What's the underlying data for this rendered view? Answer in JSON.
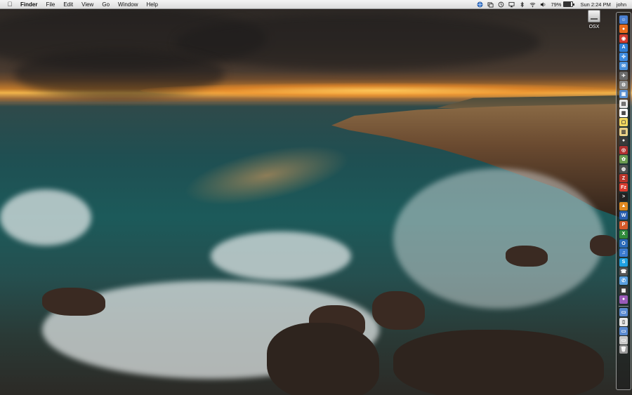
{
  "menubar": {
    "apple_icon": "apple-icon",
    "menus": [
      "Finder",
      "File",
      "Edit",
      "View",
      "Go",
      "Window",
      "Help"
    ],
    "status": {
      "battery_percent": "79%",
      "battery_level": 0.79,
      "clock": "Sun 2:24 PM",
      "user": "john"
    },
    "status_icons": [
      "globe-icon",
      "mirror-icon",
      "time-machine-icon",
      "airplay-icon",
      "bluetooth-icon",
      "wifi-icon",
      "volume-icon"
    ]
  },
  "desktop": {
    "icons": [
      {
        "label": "OSX",
        "icon": "hard-drive-icon"
      }
    ]
  },
  "dock": {
    "items": [
      {
        "name": "finder",
        "color": "#4a7fd0",
        "glyph": "☺"
      },
      {
        "name": "firefox",
        "color": "#e86a1c",
        "glyph": "●"
      },
      {
        "name": "chrome",
        "color": "#d23b2f",
        "glyph": "◉"
      },
      {
        "name": "app-store",
        "color": "#2f7fd6",
        "glyph": "A"
      },
      {
        "name": "safari",
        "color": "#3d8be0",
        "glyph": "✣"
      },
      {
        "name": "mail",
        "color": "#4a90d9",
        "glyph": "✉"
      },
      {
        "name": "launchpad",
        "color": "#6a6a6a",
        "glyph": "✈"
      },
      {
        "name": "system-preferences",
        "color": "#8a8a8a",
        "glyph": "⚙"
      },
      {
        "name": "preview",
        "color": "#5a8fd0",
        "glyph": "▣"
      },
      {
        "name": "textedit",
        "color": "#e8e8e8",
        "glyph": "▤"
      },
      {
        "name": "calendar",
        "color": "#ffffff",
        "glyph": "▦"
      },
      {
        "name": "stickies",
        "color": "#f0d860",
        "glyph": "▢"
      },
      {
        "name": "notes",
        "color": "#e8d088",
        "glyph": "▥"
      },
      {
        "name": "facetime",
        "color": "#3a3a3a",
        "glyph": "●"
      },
      {
        "name": "photo-booth",
        "color": "#b03030",
        "glyph": "◎"
      },
      {
        "name": "iphoto",
        "color": "#6a9a50",
        "glyph": "✿"
      },
      {
        "name": "dvd-player",
        "color": "#505050",
        "glyph": "◍"
      },
      {
        "name": "filezilla",
        "color": "#b8342a",
        "glyph": "Z"
      },
      {
        "name": "filezilla-alt",
        "color": "#d8392c",
        "glyph": "Fz"
      },
      {
        "name": "terminal",
        "color": "#222222",
        "glyph": ">"
      },
      {
        "name": "vlc",
        "color": "#e08a20",
        "glyph": "▲"
      },
      {
        "name": "word",
        "color": "#2b5fb0",
        "glyph": "W"
      },
      {
        "name": "powerpoint",
        "color": "#d45a2a",
        "glyph": "P"
      },
      {
        "name": "excel",
        "color": "#2f8a3a",
        "glyph": "X"
      },
      {
        "name": "outlook",
        "color": "#2a6ab8",
        "glyph": "O"
      },
      {
        "name": "itunes",
        "color": "#3a7ad0",
        "glyph": "♫"
      },
      {
        "name": "skype",
        "color": "#1fa0e0",
        "glyph": "S"
      },
      {
        "name": "wifi-diagnostics",
        "color": "#555555",
        "glyph": "☎"
      },
      {
        "name": "messages",
        "color": "#5aa0e0",
        "glyph": "✆"
      },
      {
        "name": "activity-monitor",
        "color": "#3a3a3a",
        "glyph": "▩"
      },
      {
        "name": "game-center",
        "color": "#9a5ab8",
        "glyph": "●"
      },
      {
        "name": "applications-folder",
        "color": "#5a8ad0",
        "glyph": "▭"
      },
      {
        "name": "documents-folder",
        "color": "#e8e8e8",
        "glyph": "▯"
      },
      {
        "name": "downloads-folder",
        "color": "#5a8ad0",
        "glyph": "▭"
      },
      {
        "name": "stack-folder",
        "color": "#c8c8c8",
        "glyph": "▭"
      },
      {
        "name": "trash",
        "color": "#9a9a9a",
        "glyph": "🗑"
      }
    ]
  }
}
